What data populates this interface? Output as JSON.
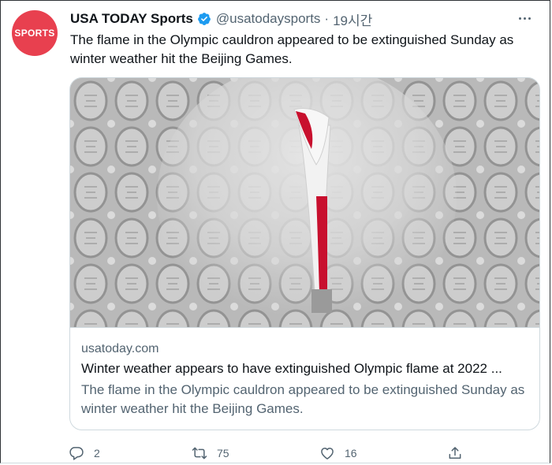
{
  "tweet": {
    "avatar_text": "SPORTS",
    "author_name": "USA TODAY Sports",
    "handle": "@usatodaysports",
    "separator": "·",
    "time": "19시간",
    "text": "The flame in the Olympic cauldron appeared to be extinguished Sunday as winter weather hit the Beijing Games."
  },
  "card": {
    "domain": "usatoday.com",
    "title": "Winter weather appears to have extinguished Olympic flame at 2022 ...",
    "description": "The flame in the Olympic cauldron appeared to be extinguished Sunday as winter weather hit the Beijing Games."
  },
  "actions": {
    "reply_count": "2",
    "retweet_count": "75",
    "like_count": "16"
  },
  "colors": {
    "avatar": "#e8404f",
    "verified": "#1d9bf0",
    "secondary_text": "#536471",
    "torch_red": "#c8102e"
  },
  "icons": [
    "verified-badge-icon",
    "more-options-icon",
    "reply-icon",
    "retweet-icon",
    "like-icon",
    "share-icon"
  ]
}
